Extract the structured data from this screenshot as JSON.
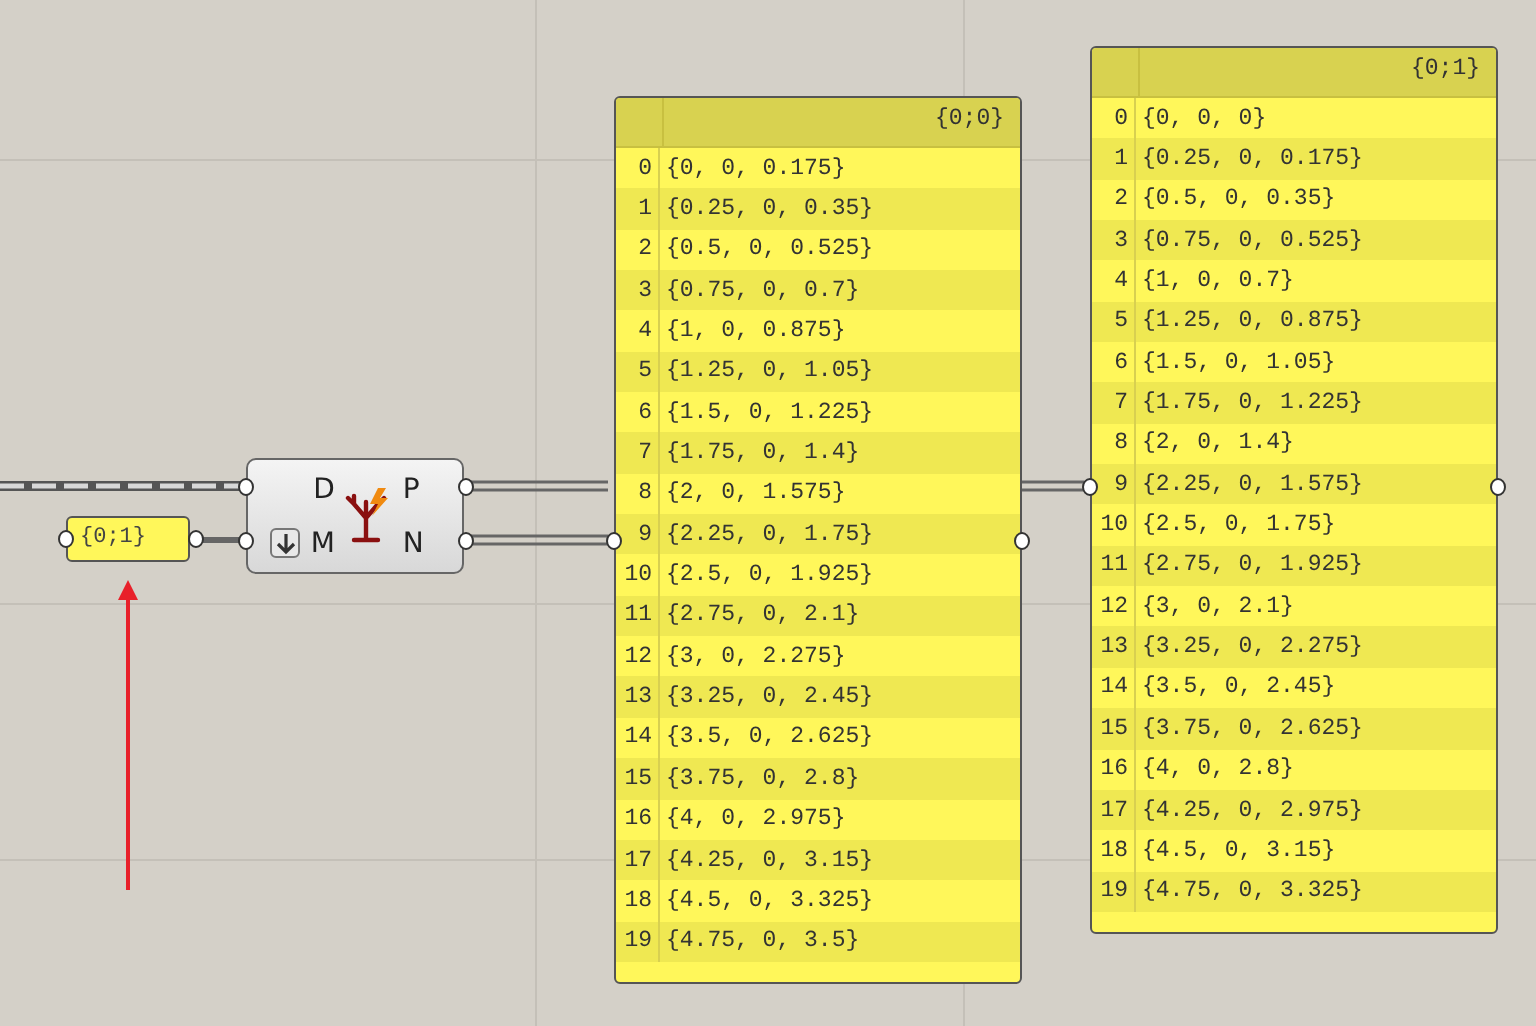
{
  "param": {
    "text": "{0;1}"
  },
  "component": {
    "inputs": [
      {
        "label": "D",
        "graft": false
      },
      {
        "label": "M",
        "graft": true
      }
    ],
    "outputs": [
      {
        "label": "P"
      },
      {
        "label": "N"
      }
    ]
  },
  "panels": [
    {
      "header": "{0;0}",
      "items": [
        {
          "index": "0",
          "value": "{0, 0, 0.175}"
        },
        {
          "index": "1",
          "value": "{0.25, 0, 0.35}"
        },
        {
          "index": "2",
          "value": "{0.5, 0, 0.525}"
        },
        {
          "index": "3",
          "value": "{0.75, 0, 0.7}"
        },
        {
          "index": "4",
          "value": "{1, 0, 0.875}"
        },
        {
          "index": "5",
          "value": "{1.25, 0, 1.05}"
        },
        {
          "index": "6",
          "value": "{1.5, 0, 1.225}"
        },
        {
          "index": "7",
          "value": "{1.75, 0, 1.4}"
        },
        {
          "index": "8",
          "value": "{2, 0, 1.575}"
        },
        {
          "index": "9",
          "value": "{2.25, 0, 1.75}"
        },
        {
          "index": "10",
          "value": "{2.5, 0, 1.925}"
        },
        {
          "index": "11",
          "value": "{2.75, 0, 2.1}"
        },
        {
          "index": "12",
          "value": "{3, 0, 2.275}"
        },
        {
          "index": "13",
          "value": "{3.25, 0, 2.45}"
        },
        {
          "index": "14",
          "value": "{3.5, 0, 2.625}"
        },
        {
          "index": "15",
          "value": "{3.75, 0, 2.8}"
        },
        {
          "index": "16",
          "value": "{4, 0, 2.975}"
        },
        {
          "index": "17",
          "value": "{4.25, 0, 3.15}"
        },
        {
          "index": "18",
          "value": "{4.5, 0, 3.325}"
        },
        {
          "index": "19",
          "value": "{4.75, 0, 3.5}"
        }
      ]
    },
    {
      "header": "{0;1}",
      "items": [
        {
          "index": "0",
          "value": "{0, 0, 0}"
        },
        {
          "index": "1",
          "value": "{0.25, 0, 0.175}"
        },
        {
          "index": "2",
          "value": "{0.5, 0, 0.35}"
        },
        {
          "index": "3",
          "value": "{0.75, 0, 0.525}"
        },
        {
          "index": "4",
          "value": "{1, 0, 0.7}"
        },
        {
          "index": "5",
          "value": "{1.25, 0, 0.875}"
        },
        {
          "index": "6",
          "value": "{1.5, 0, 1.05}"
        },
        {
          "index": "7",
          "value": "{1.75, 0, 1.225}"
        },
        {
          "index": "8",
          "value": "{2, 0, 1.4}"
        },
        {
          "index": "9",
          "value": "{2.25, 0, 1.575}"
        },
        {
          "index": "10",
          "value": "{2.5, 0, 1.75}"
        },
        {
          "index": "11",
          "value": "{2.75, 0, 1.925}"
        },
        {
          "index": "12",
          "value": "{3, 0, 2.1}"
        },
        {
          "index": "13",
          "value": "{3.25, 0, 2.275}"
        },
        {
          "index": "14",
          "value": "{3.5, 0, 2.45}"
        },
        {
          "index": "15",
          "value": "{3.75, 0, 2.625}"
        },
        {
          "index": "16",
          "value": "{4, 0, 2.8}"
        },
        {
          "index": "17",
          "value": "{4.25, 0, 2.975}"
        },
        {
          "index": "18",
          "value": "{4.5, 0, 3.15}"
        },
        {
          "index": "19",
          "value": "{4.75, 0, 3.325}"
        }
      ]
    }
  ]
}
